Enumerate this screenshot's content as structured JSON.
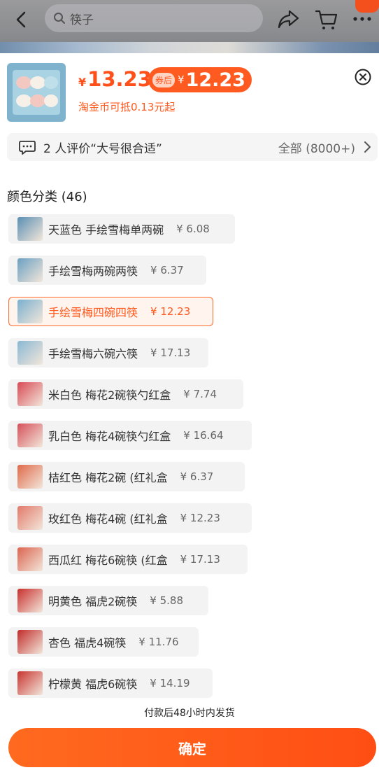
{
  "topbar": {
    "search_text": "筷子"
  },
  "product": {
    "currency": "¥",
    "price": "13.23",
    "coupon_tag": "券后",
    "coupon_price": "12.23",
    "coin_text": "淘金币可抵0.13元起"
  },
  "review": {
    "text": "2 人评价“大号很合适”",
    "all": "全部 (8000+)"
  },
  "section": {
    "title": "颜色分类 (46)"
  },
  "options": [
    {
      "label": "天蓝色 手绘雪梅单两碗",
      "price": "¥ 6.08",
      "selected": false,
      "thumb": "#5a8fb3"
    },
    {
      "label": "手绘雪梅两碗两筷",
      "price": "¥ 6.37",
      "selected": false,
      "thumb": "#6aa0c2"
    },
    {
      "label": "手绘雪梅四碗四筷",
      "price": "¥ 12.23",
      "selected": true,
      "thumb": "#7ab0cf"
    },
    {
      "label": "手绘雪梅六碗六筷",
      "price": "¥ 17.13",
      "selected": false,
      "thumb": "#8ab8d4"
    },
    {
      "label": "米白色 梅花2碗筷勺红盒",
      "price": "¥ 7.74",
      "selected": false,
      "thumb": "#d84a55"
    },
    {
      "label": "乳白色 梅花4碗筷勺红盒",
      "price": "¥ 16.64",
      "selected": false,
      "thumb": "#d6505a"
    },
    {
      "label": "桔红色 梅花2碗 (红礼盒",
      "price": "¥ 6.37",
      "selected": false,
      "thumb": "#e06a4a"
    },
    {
      "label": "玫红色 梅花4碗 (红礼盒",
      "price": "¥ 12.23",
      "selected": false,
      "thumb": "#e27a6a"
    },
    {
      "label": "西瓜红 梅花6碗筷 (红盒",
      "price": "¥ 17.13",
      "selected": false,
      "thumb": "#dc6450"
    },
    {
      "label": "明黄色 福虎2碗筷",
      "price": "¥ 5.88",
      "selected": false,
      "thumb": "#c9302e"
    },
    {
      "label": "杏色 福虎4碗筷",
      "price": "¥ 11.76",
      "selected": false,
      "thumb": "#c22c2a"
    },
    {
      "label": "柠檬黄 福虎6碗筷",
      "price": "¥ 14.19",
      "selected": false,
      "thumb": "#c83430"
    }
  ],
  "footer": {
    "ship_note": "付款后48小时内发货",
    "confirm": "确定"
  },
  "colors": {
    "accent": "#ff5a1f",
    "selected_bg": "#fff4ee",
    "option_bg": "#f3f3f3"
  }
}
